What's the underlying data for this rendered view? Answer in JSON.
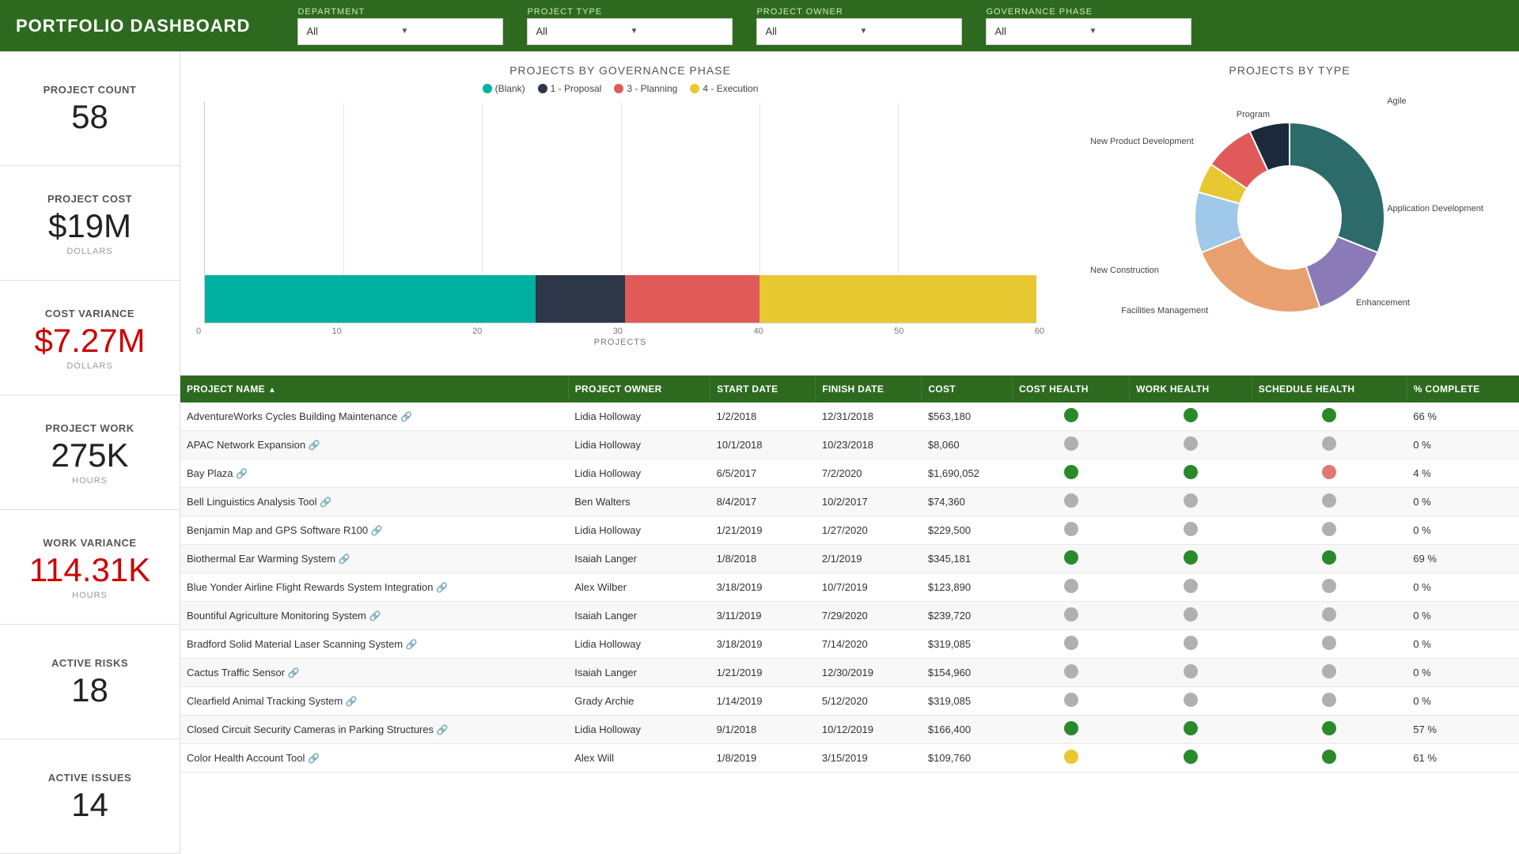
{
  "header": {
    "title": "PORTFOLIO DASHBOARD",
    "filters": [
      {
        "label": "DEPARTMENT",
        "value": "All",
        "options": [
          "All"
        ]
      },
      {
        "label": "PROJECT TYPE",
        "value": "All",
        "options": [
          "All"
        ]
      },
      {
        "label": "PROJECT OWNER",
        "value": "All",
        "options": [
          "All"
        ]
      },
      {
        "label": "GOVERNANCE PHASE",
        "value": "All",
        "options": [
          "All"
        ]
      }
    ]
  },
  "sidebar": {
    "stats": [
      {
        "id": "project-count",
        "label": "PROJECT COUNT",
        "value": "58",
        "sub": "",
        "red": false
      },
      {
        "id": "project-cost",
        "label": "PROJECT COST",
        "value": "$19M",
        "sub": "DOLLARS",
        "red": false
      },
      {
        "id": "cost-variance",
        "label": "COST VARIANCE",
        "value": "$7.27M",
        "sub": "DOLLARS",
        "red": true
      },
      {
        "id": "project-work",
        "label": "PROJECT WORK",
        "value": "275K",
        "sub": "HOURS",
        "red": false
      },
      {
        "id": "work-variance",
        "label": "WORK VARIANCE",
        "value": "114.31K",
        "sub": "HOURS",
        "red": true
      },
      {
        "id": "active-risks",
        "label": "ACTIVE RISKS",
        "value": "18",
        "sub": "",
        "red": false
      },
      {
        "id": "active-issues",
        "label": "ACTIVE ISSUES",
        "value": "14",
        "sub": "",
        "red": false
      }
    ]
  },
  "bar_chart": {
    "title": "PROJECTS BY GOVERNANCE PHASE",
    "legend": [
      {
        "label": "(Blank)",
        "color": "#00b0a0"
      },
      {
        "label": "1 - Proposal",
        "color": "#2d3748"
      },
      {
        "label": "3 - Planning",
        "color": "#e05a5a"
      },
      {
        "label": "4 - Execution",
        "color": "#e8c830"
      }
    ],
    "axis_labels": [
      "0",
      "10",
      "20",
      "30",
      "40",
      "50",
      "60"
    ],
    "x_label": "PROJECTS",
    "segments": [
      {
        "color": "#00b0a0",
        "width_pct": 37
      },
      {
        "color": "#2d3748",
        "width_pct": 10
      },
      {
        "color": "#e05a5a",
        "width_pct": 15
      },
      {
        "color": "#e8c830",
        "width_pct": 31
      }
    ]
  },
  "donut_chart": {
    "title": "PROJECTS BY TYPE",
    "segments": [
      {
        "label": "Agile",
        "color": "#2d6a6a",
        "value": 18
      },
      {
        "label": "Program",
        "color": "#8b7ab8",
        "value": 8
      },
      {
        "label": "New Product Development",
        "color": "#e8a070",
        "value": 14
      },
      {
        "label": "New Construction",
        "color": "#a0c8e8",
        "value": 6
      },
      {
        "label": "Facilities Management",
        "color": "#e8c830",
        "value": 3
      },
      {
        "label": "Enhancement",
        "color": "#e05a5a",
        "value": 5
      },
      {
        "label": "Application Development",
        "color": "#1a2a3a",
        "value": 4
      }
    ]
  },
  "table": {
    "columns": [
      "PROJECT NAME",
      "PROJECT OWNER",
      "START DATE",
      "FINISH DATE",
      "COST",
      "COST HEALTH",
      "WORK HEALTH",
      "SCHEDULE HEALTH",
      "% COMPLETE"
    ],
    "rows": [
      {
        "name": "AdventureWorks Cycles Building Maintenance",
        "owner": "Lidia Holloway",
        "start": "1/2/2018",
        "finish": "12/31/2018",
        "cost": "$563,180",
        "cost_health": "green",
        "work_health": "green",
        "schedule_health": "green",
        "pct": "66 %"
      },
      {
        "name": "APAC Network Expansion",
        "owner": "Lidia Holloway",
        "start": "10/1/2018",
        "finish": "10/23/2018",
        "cost": "$8,060",
        "cost_health": "gray",
        "work_health": "gray",
        "schedule_health": "gray",
        "pct": "0 %"
      },
      {
        "name": "Bay Plaza",
        "owner": "Lidia Holloway",
        "start": "6/5/2017",
        "finish": "7/2/2020",
        "cost": "$1,690,052",
        "cost_health": "green",
        "work_health": "green",
        "schedule_health": "salmon",
        "pct": "4 %"
      },
      {
        "name": "Bell Linguistics Analysis Tool",
        "owner": "Ben Walters",
        "start": "8/4/2017",
        "finish": "10/2/2017",
        "cost": "$74,360",
        "cost_health": "gray",
        "work_health": "gray",
        "schedule_health": "gray",
        "pct": "0 %"
      },
      {
        "name": "Benjamin Map and GPS Software R100",
        "owner": "Lidia Holloway",
        "start": "1/21/2019",
        "finish": "1/27/2020",
        "cost": "$229,500",
        "cost_health": "gray",
        "work_health": "gray",
        "schedule_health": "gray",
        "pct": "0 %"
      },
      {
        "name": "Biothermal Ear Warming System",
        "owner": "Isaiah Langer",
        "start": "1/8/2018",
        "finish": "2/1/2019",
        "cost": "$345,181",
        "cost_health": "green",
        "work_health": "green",
        "schedule_health": "green",
        "pct": "69 %"
      },
      {
        "name": "Blue Yonder Airline Flight Rewards System Integration",
        "owner": "Alex Wilber",
        "start": "3/18/2019",
        "finish": "10/7/2019",
        "cost": "$123,890",
        "cost_health": "gray",
        "work_health": "gray",
        "schedule_health": "gray",
        "pct": "0 %"
      },
      {
        "name": "Bountiful Agriculture Monitoring System",
        "owner": "Isaiah Langer",
        "start": "3/11/2019",
        "finish": "7/29/2020",
        "cost": "$239,720",
        "cost_health": "gray",
        "work_health": "gray",
        "schedule_health": "gray",
        "pct": "0 %"
      },
      {
        "name": "Bradford Solid Material Laser Scanning System",
        "owner": "Lidia Holloway",
        "start": "3/18/2019",
        "finish": "7/14/2020",
        "cost": "$319,085",
        "cost_health": "gray",
        "work_health": "gray",
        "schedule_health": "gray",
        "pct": "0 %"
      },
      {
        "name": "Cactus Traffic Sensor",
        "owner": "Isaiah Langer",
        "start": "1/21/2019",
        "finish": "12/30/2019",
        "cost": "$154,960",
        "cost_health": "gray",
        "work_health": "gray",
        "schedule_health": "gray",
        "pct": "0 %"
      },
      {
        "name": "Clearfield Animal Tracking System",
        "owner": "Grady Archie",
        "start": "1/14/2019",
        "finish": "5/12/2020",
        "cost": "$319,085",
        "cost_health": "gray",
        "work_health": "gray",
        "schedule_health": "gray",
        "pct": "0 %"
      },
      {
        "name": "Closed Circuit Security Cameras in Parking Structures",
        "owner": "Lidia Holloway",
        "start": "9/1/2018",
        "finish": "10/12/2019",
        "cost": "$166,400",
        "cost_health": "green",
        "work_health": "green",
        "schedule_health": "green",
        "pct": "57 %"
      },
      {
        "name": "Color Health Account Tool",
        "owner": "Alex Will",
        "start": "1/8/2019",
        "finish": "3/15/2019",
        "cost": "$109,760",
        "cost_health": "yellow",
        "work_health": "green",
        "schedule_health": "green",
        "pct": "61 %"
      }
    ]
  },
  "colors": {
    "header_bg": "#2d6a1f",
    "health_green": "#2a8a2a",
    "health_gray": "#b0b0b0",
    "health_salmon": "#e07878",
    "health_yellow": "#e8c830",
    "red_text": "#cc0000"
  }
}
